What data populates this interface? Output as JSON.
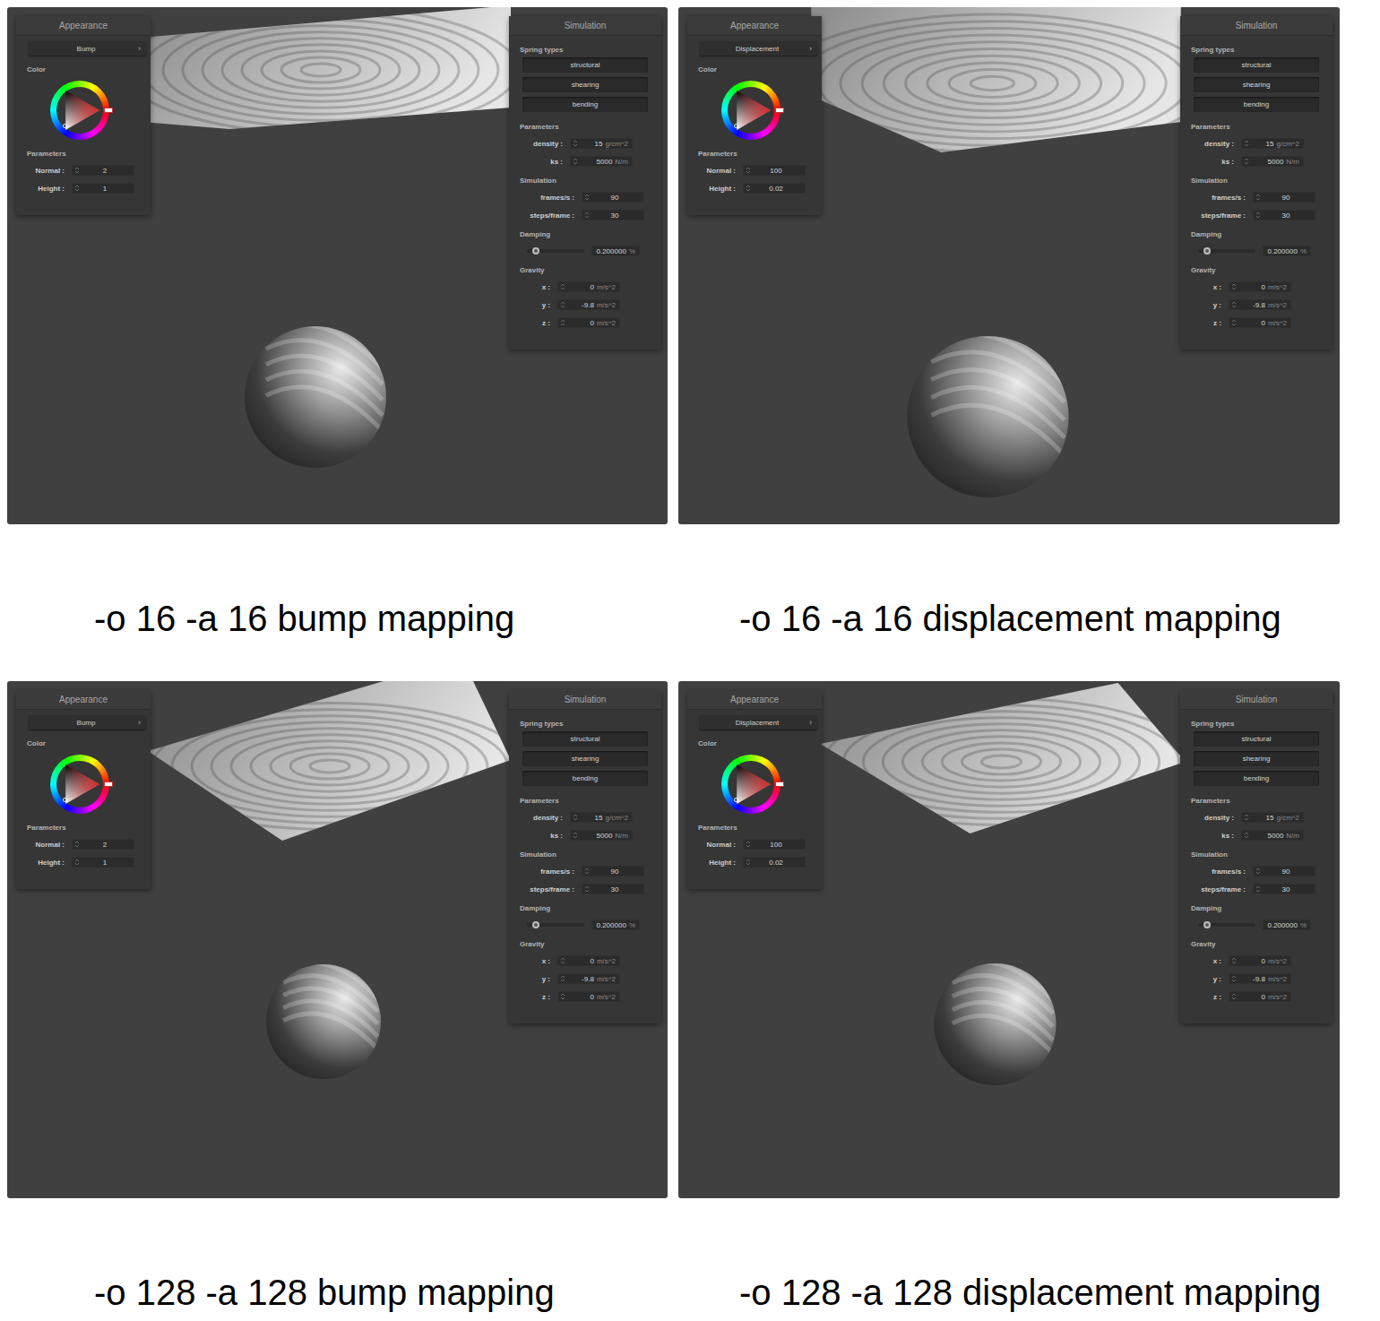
{
  "figures": [
    {
      "caption": "-o 16 -a 16 bump mapping",
      "appearance": {
        "title": "Appearance",
        "shader": "Bump",
        "dropdown_icon": "›",
        "color_label": "Color",
        "color": "#d32f2f",
        "params_label": "Parameters",
        "params": [
          {
            "label": "Normal :",
            "value": "2"
          },
          {
            "label": "Height :",
            "value": "1"
          }
        ]
      },
      "simulation": {
        "title": "Simulation",
        "spring_label": "Spring types",
        "springs": [
          {
            "label": "structural",
            "on": true
          },
          {
            "label": "shearing",
            "on": true
          },
          {
            "label": "bending",
            "on": true
          }
        ],
        "params_label": "Parameters",
        "params": [
          {
            "label": "density :",
            "value": "15",
            "unit": "g/cm^2"
          },
          {
            "label": "ks :",
            "value": "5000",
            "unit": "N/m"
          }
        ],
        "sim_label": "Simulation",
        "sim": [
          {
            "label": "frames/s :",
            "value": "90"
          },
          {
            "label": "steps/frame :",
            "value": "30"
          }
        ],
        "damping_label": "Damping",
        "damping": {
          "level": 0.15,
          "value": "0.200000",
          "unit": "%"
        },
        "gravity_label": "Gravity",
        "gravity": [
          {
            "label": "x :",
            "value": "0",
            "unit": "m/s^2"
          },
          {
            "label": "y :",
            "value": "-9.8",
            "unit": "m/s^2"
          },
          {
            "label": "z :",
            "value": "0",
            "unit": "m/s^2"
          }
        ]
      }
    },
    {
      "caption": "-o 16 -a 16 displacement mapping",
      "appearance": {
        "title": "Appearance",
        "shader": "Displacement",
        "dropdown_icon": "›",
        "color_label": "Color",
        "color": "#d32f2f",
        "params_label": "Parameters",
        "params": [
          {
            "label": "Normal :",
            "value": "100"
          },
          {
            "label": "Height :",
            "value": "0.02"
          }
        ]
      },
      "simulation": {
        "title": "Simulation",
        "spring_label": "Spring types",
        "springs": [
          {
            "label": "structural",
            "on": true
          },
          {
            "label": "shearing",
            "on": true
          },
          {
            "label": "bending",
            "on": true
          }
        ],
        "params_label": "Parameters",
        "params": [
          {
            "label": "density :",
            "value": "15",
            "unit": "g/cm^2"
          },
          {
            "label": "ks :",
            "value": "5000",
            "unit": "N/m"
          }
        ],
        "sim_label": "Simulation",
        "sim": [
          {
            "label": "frames/s :",
            "value": "90"
          },
          {
            "label": "steps/frame :",
            "value": "30"
          }
        ],
        "damping_label": "Damping",
        "damping": {
          "level": 0.15,
          "value": "0.200000",
          "unit": "%"
        },
        "gravity_label": "Gravity",
        "gravity": [
          {
            "label": "x :",
            "value": "0",
            "unit": "m/s^2"
          },
          {
            "label": "y :",
            "value": "-9.8",
            "unit": "m/s^2"
          },
          {
            "label": "z :",
            "value": "0",
            "unit": "m/s^2"
          }
        ]
      }
    },
    {
      "caption": "-o 128 -a 128 bump mapping",
      "appearance": {
        "title": "Appearance",
        "shader": "Bump",
        "dropdown_icon": "›",
        "color_label": "Color",
        "color": "#d32f2f",
        "params_label": "Parameters",
        "params": [
          {
            "label": "Normal :",
            "value": "2"
          },
          {
            "label": "Height :",
            "value": "1"
          }
        ]
      },
      "simulation": {
        "title": "Simulation",
        "spring_label": "Spring types",
        "springs": [
          {
            "label": "structural",
            "on": true
          },
          {
            "label": "shearing",
            "on": true
          },
          {
            "label": "bending",
            "on": true
          }
        ],
        "params_label": "Parameters",
        "params": [
          {
            "label": "density :",
            "value": "15",
            "unit": "g/cm^2"
          },
          {
            "label": "ks :",
            "value": "5000",
            "unit": "N/m"
          }
        ],
        "sim_label": "Simulation",
        "sim": [
          {
            "label": "frames/s :",
            "value": "90"
          },
          {
            "label": "steps/frame :",
            "value": "30"
          }
        ],
        "damping_label": "Damping",
        "damping": {
          "level": 0.15,
          "value": "0.200000",
          "unit": "%"
        },
        "gravity_label": "Gravity",
        "gravity": [
          {
            "label": "x :",
            "value": "0",
            "unit": "m/s^2"
          },
          {
            "label": "y :",
            "value": "-9.8",
            "unit": "m/s^2"
          },
          {
            "label": "z :",
            "value": "0",
            "unit": "m/s^2"
          }
        ]
      }
    },
    {
      "caption": "-o 128 -a 128 displacement mapping",
      "appearance": {
        "title": "Appearance",
        "shader": "Displacement",
        "dropdown_icon": "›",
        "color_label": "Color",
        "color": "#d32f2f",
        "params_label": "Parameters",
        "params": [
          {
            "label": "Normal :",
            "value": "100"
          },
          {
            "label": "Height :",
            "value": "0.02"
          }
        ]
      },
      "simulation": {
        "title": "Simulation",
        "spring_label": "Spring types",
        "springs": [
          {
            "label": "structural",
            "on": true
          },
          {
            "label": "shearing",
            "on": true
          },
          {
            "label": "bending",
            "on": true
          }
        ],
        "params_label": "Parameters",
        "params": [
          {
            "label": "density :",
            "value": "15",
            "unit": "g/cm^2"
          },
          {
            "label": "ks :",
            "value": "5000",
            "unit": "N/m"
          }
        ],
        "sim_label": "Simulation",
        "sim": [
          {
            "label": "frames/s :",
            "value": "90"
          },
          {
            "label": "steps/frame :",
            "value": "30"
          }
        ],
        "damping_label": "Damping",
        "damping": {
          "level": 0.15,
          "value": "0.200000",
          "unit": "%"
        },
        "gravity_label": "Gravity",
        "gravity": [
          {
            "label": "x :",
            "value": "0",
            "unit": "m/s^2"
          },
          {
            "label": "y :",
            "value": "-9.8",
            "unit": "m/s^2"
          },
          {
            "label": "z :",
            "value": "0",
            "unit": "m/s^2"
          }
        ]
      }
    }
  ]
}
